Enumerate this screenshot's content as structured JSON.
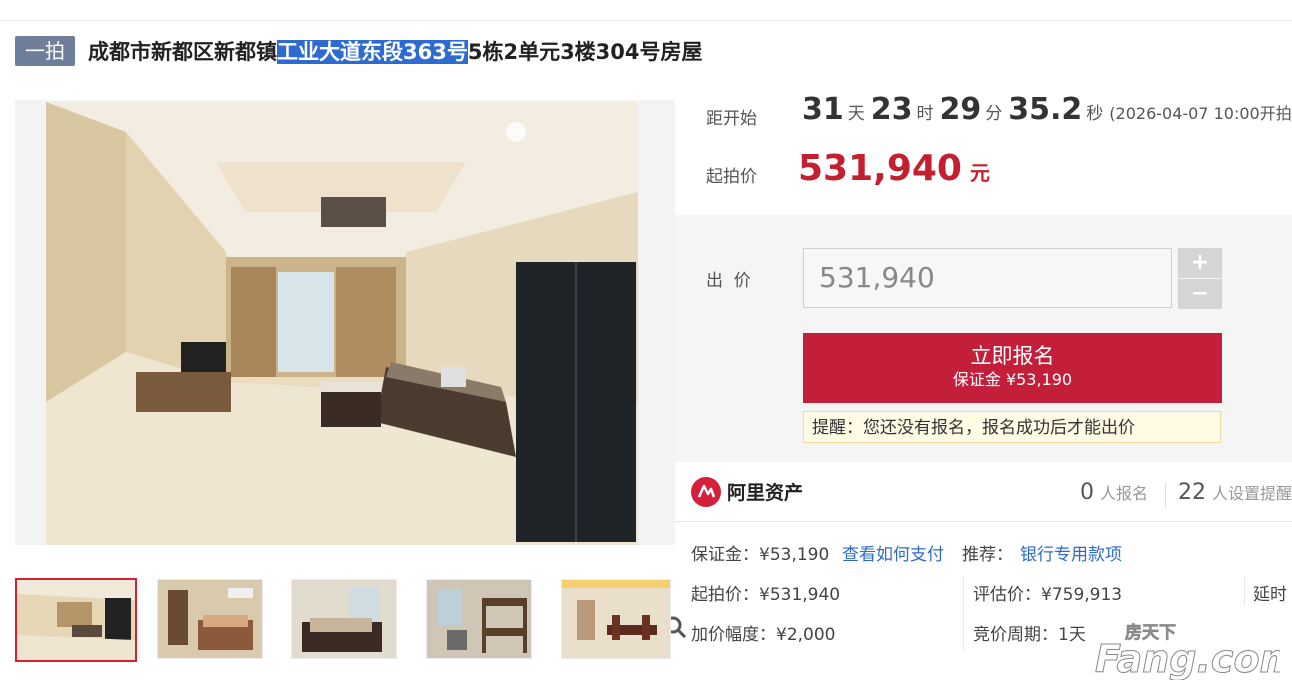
{
  "header": {
    "badge": "一拍",
    "title_pre": "成都市新都区新都镇",
    "title_highlight": "工业大道东段363号",
    "title_post": "5栋2单元3楼304号房屋"
  },
  "gallery": {
    "zoom_icon": "magnifier-icon",
    "thumbnails": [
      "living-room",
      "bedroom",
      "bedroom-2",
      "bunk-room",
      "dining-room"
    ],
    "selected_index": 0
  },
  "countdown": {
    "label": "距开始",
    "days": "31",
    "days_unit": "天",
    "hours": "23",
    "hours_unit": "时",
    "minutes": "29",
    "minutes_unit": "分",
    "seconds": "35.2",
    "seconds_unit": "秒",
    "start_time": "(2026-04-07 10:00开拍)"
  },
  "starting_price": {
    "label": "起拍价",
    "value": "531,940",
    "unit": "元"
  },
  "bid": {
    "label": "出  价",
    "input_value": "531,940",
    "plus": "+",
    "minus": "−",
    "apply_label": "立即报名",
    "deposit_line": "保证金 ¥53,190",
    "reminder": "提醒：您还没有报名，报名成功后才能出价"
  },
  "brand": {
    "name": "阿里资产",
    "signups_num": "0",
    "signups_label": "人报名",
    "reminders_num": "22",
    "reminders_label": "人设置提醒"
  },
  "details": {
    "deposit": "保证金：¥53,190",
    "how_to_pay": "查看如何支付",
    "recommend_label": "推荐：",
    "recommend_link": "银行专用款项",
    "start_price": "起拍价：¥531,940",
    "appraisal": "评估价：¥759,913",
    "delay": "延时",
    "increment": "加价幅度：¥2,000",
    "cycle": "竞价周期：1天"
  },
  "watermark": {
    "cn": "房天下",
    "en": "Fang.com"
  },
  "colors": {
    "accent_red": "#c41f3a",
    "price_red": "#c41f2f",
    "badge": "#6f7f9b",
    "link": "#2e6bc9",
    "highlight": "#2e6bd1"
  }
}
